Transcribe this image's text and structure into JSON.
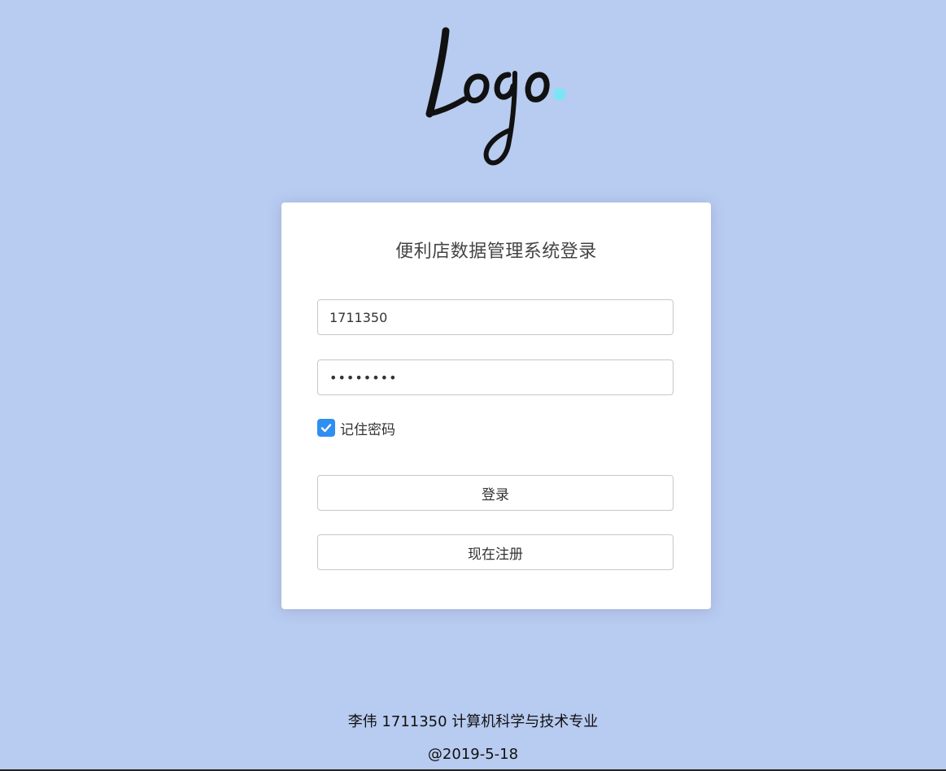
{
  "logo": {
    "text": "Logo",
    "dot_color": "#7fe3f6",
    "ink_color": "#111111"
  },
  "login_card": {
    "title": "便利店数据管理系统登录",
    "username": {
      "value": "1711350"
    },
    "password": {
      "value": "12345678"
    },
    "remember": {
      "label": "记住密码",
      "checked": true,
      "icon": "check-icon"
    },
    "login_button": "登录",
    "register_button": "现在注册"
  },
  "footer": {
    "line1": "李伟 1711350 计算机科学与技术专业",
    "line2": "@2019-5-18"
  },
  "colors": {
    "background": "#b8cbf0",
    "card": "#ffffff",
    "checkbox": "#2f8ff0"
  }
}
